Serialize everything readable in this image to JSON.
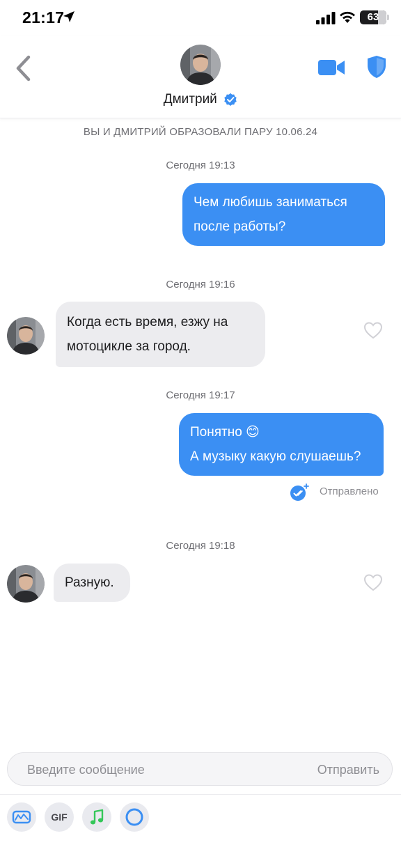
{
  "status_bar": {
    "time": "21:17",
    "battery": "63"
  },
  "header": {
    "contact_name": "Дмитрий",
    "verified": true,
    "accent_color": "#3b8ff3"
  },
  "chat": {
    "match_notice": "ВЫ И ДМИТРИЙ ОБРАЗОВАЛИ ПАРУ 10.06.24",
    "messages": [
      {
        "timestamp": "Сегодня 19:13",
        "direction": "out",
        "lines": [
          "Чем любишь заниматься",
          "после работы?"
        ]
      },
      {
        "timestamp": "Сегодня 19:16",
        "direction": "in",
        "lines": [
          "Когда есть время, езжу на",
          "мотоцикле за город."
        ]
      },
      {
        "timestamp": "Сегодня 19:17",
        "direction": "out",
        "lines": [
          "Понятно 😊",
          "А музыку какую слушаешь?"
        ],
        "status": "Отправлено"
      },
      {
        "timestamp": "Сегодня 19:18",
        "direction": "in",
        "lines": [
          "Разную."
        ]
      }
    ]
  },
  "composer": {
    "placeholder": "Введите сообщение",
    "send_label": "Отправить",
    "tools": [
      {
        "icon": "voice-message-icon"
      },
      {
        "label": "GIF"
      },
      {
        "icon": "music-icon"
      },
      {
        "icon": "circle-video-icon"
      }
    ]
  }
}
